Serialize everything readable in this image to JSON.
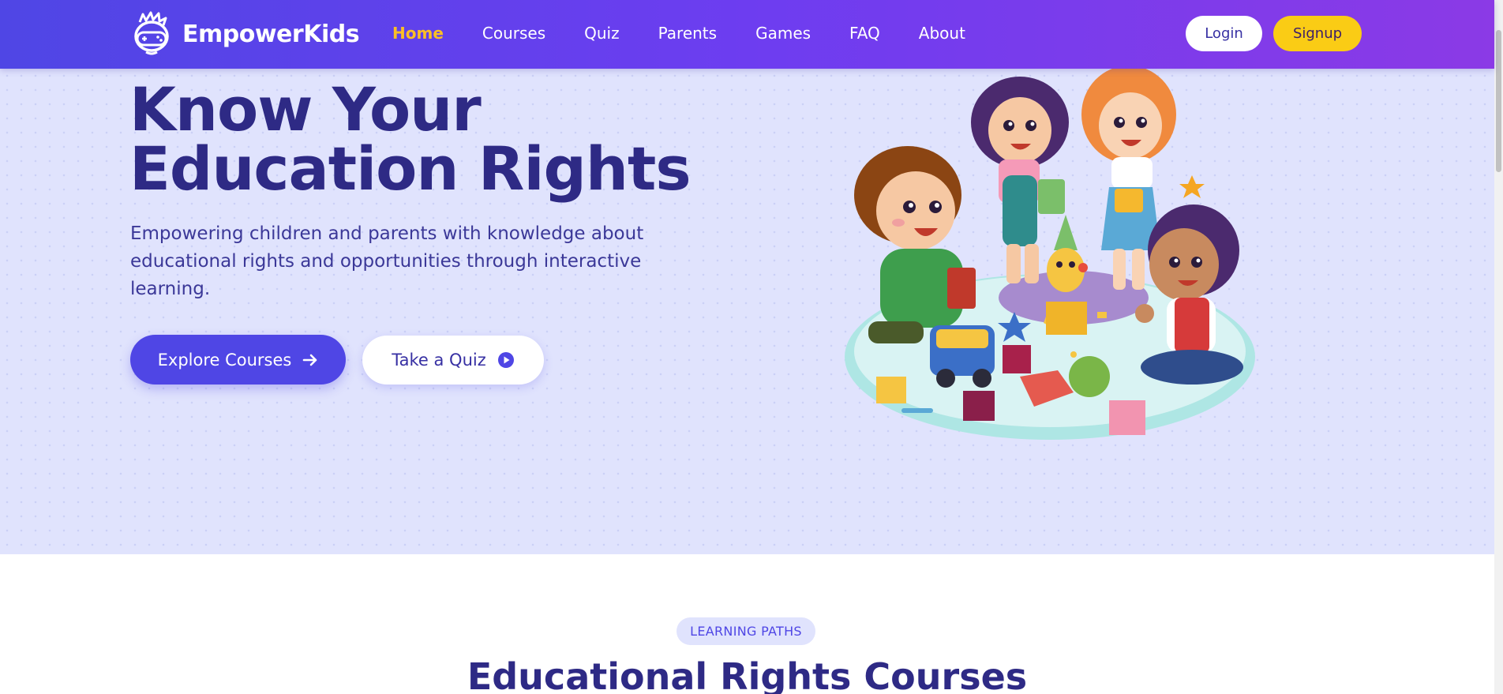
{
  "brand": {
    "name": "EmpowerKids"
  },
  "nav": {
    "items": [
      {
        "label": "Home",
        "active": true
      },
      {
        "label": "Courses",
        "active": false
      },
      {
        "label": "Quiz",
        "active": false
      },
      {
        "label": "Parents",
        "active": false
      },
      {
        "label": "Games",
        "active": false
      },
      {
        "label": "FAQ",
        "active": false
      },
      {
        "label": "About",
        "active": false
      }
    ],
    "login_label": "Login",
    "signup_label": "Signup"
  },
  "hero": {
    "title_line1": "Know Your",
    "title_line2": "Education Rights",
    "subtitle": "Empowering children and parents with knowledge about educational rights and opportunities through interactive learning.",
    "explore_label": "Explore Courses",
    "quiz_label": "Take a Quiz",
    "explore_icon": "arrow-right-icon",
    "quiz_icon": "play-circle-icon",
    "illustration": "children-playing-with-toys-illustration"
  },
  "courses_section": {
    "badge": "LEARNING PATHS",
    "title": "Educational Rights Courses"
  },
  "colors": {
    "primary": "#4f46e5",
    "nav_gradient_end": "#8b3ae6",
    "accent_yellow": "#facc15",
    "heading": "#2e2a85",
    "hero_bg": "#e0e3fd"
  }
}
